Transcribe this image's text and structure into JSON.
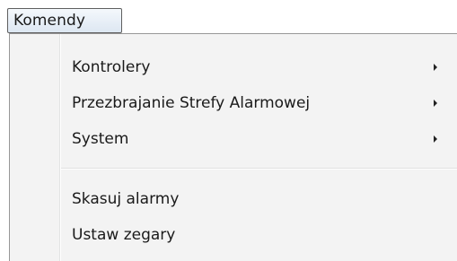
{
  "menubar": {
    "title": "Komendy"
  },
  "menu": {
    "items": [
      {
        "label": "Kontrolery",
        "has_submenu": true,
        "icon": "chevron-right-icon"
      },
      {
        "label": "Przezbrajanie Strefy Alarmowej",
        "has_submenu": true,
        "icon": "chevron-right-icon"
      },
      {
        "label": "System",
        "has_submenu": true,
        "icon": "chevron-right-icon"
      },
      {
        "label": "Skasuj alarmy",
        "has_submenu": false
      },
      {
        "label": "Ustaw zegary",
        "has_submenu": false
      }
    ]
  },
  "colors": {
    "menu_background": "#f3f3f3",
    "menubar_border": "#5f5f5f",
    "text": "#1a1a1a"
  }
}
